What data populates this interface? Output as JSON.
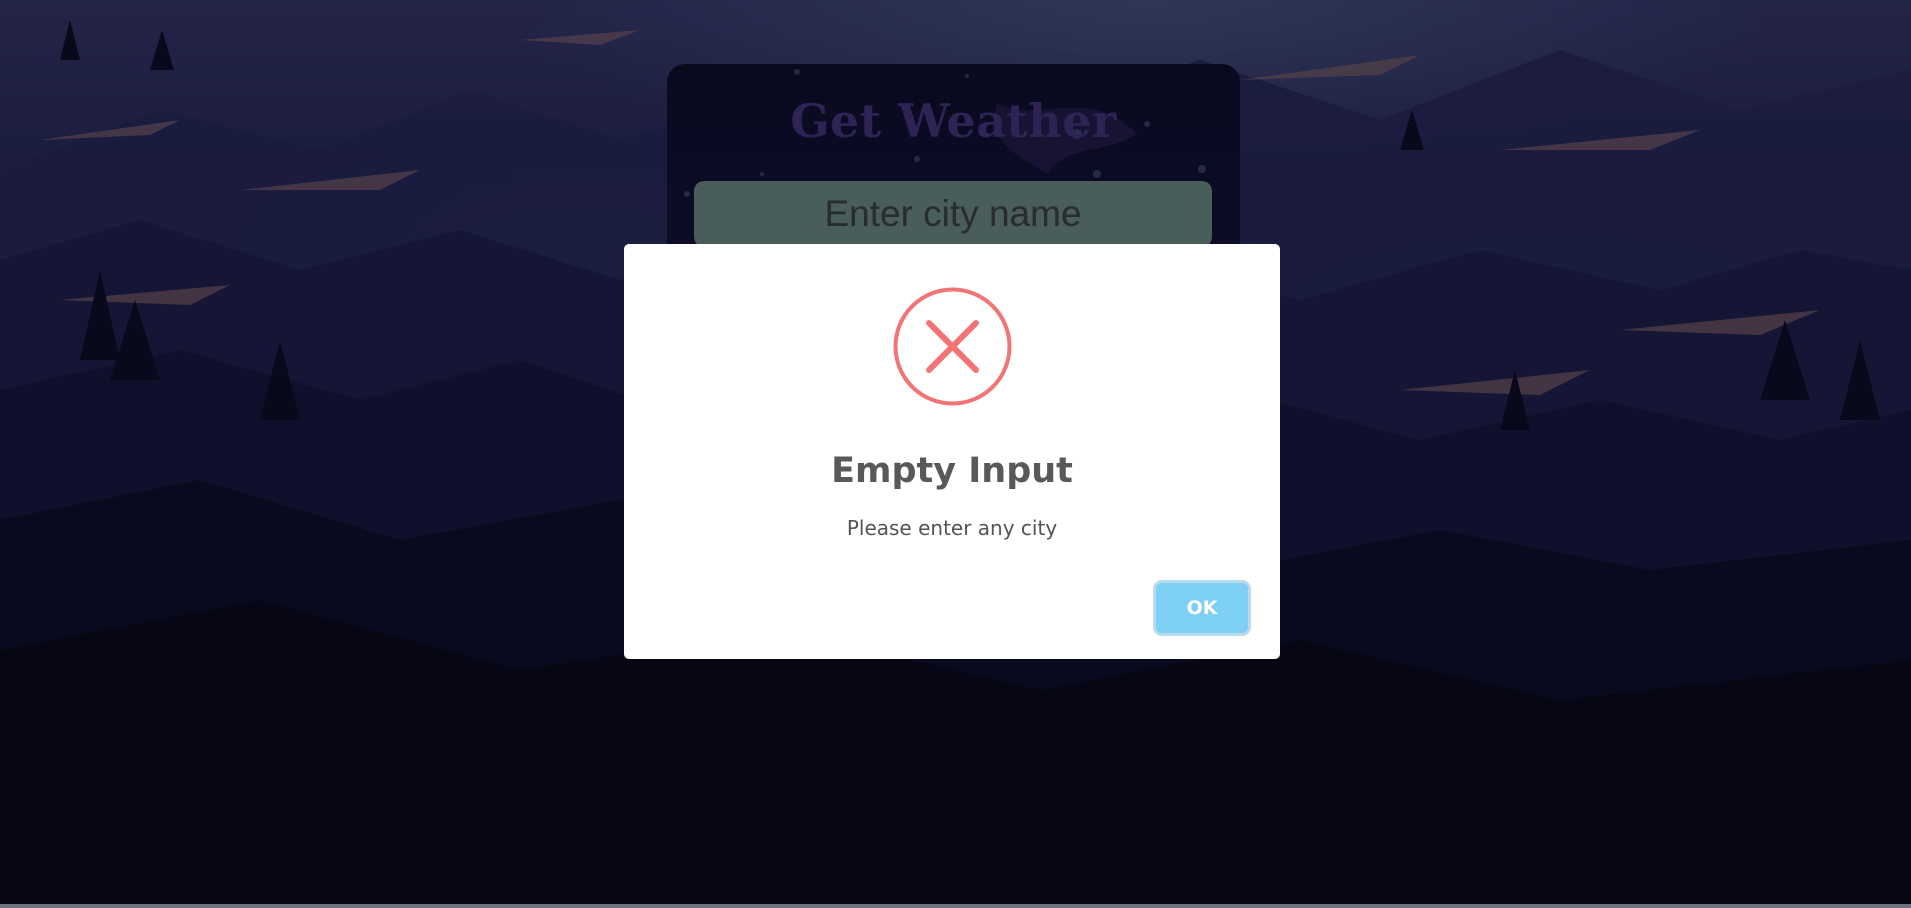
{
  "app": {
    "title": "Get Weather"
  },
  "search": {
    "placeholder": "Enter city name",
    "value": ""
  },
  "alert": {
    "icon": "error-x-icon",
    "title": "Empty Input",
    "text": "Please enter any city",
    "confirm_label": "OK"
  },
  "colors": {
    "title": "#4b3c8e",
    "input_bg": "#7a9b98",
    "error_red": "#f27474",
    "confirm_button": "#7ecff4"
  }
}
